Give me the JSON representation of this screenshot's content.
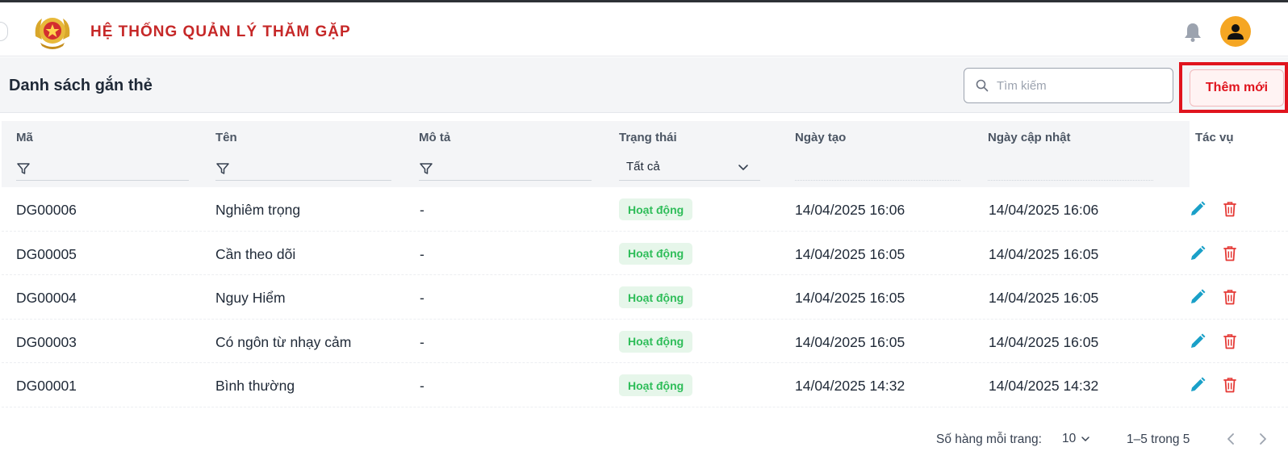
{
  "header": {
    "app_title": "HỆ THỐNG QUẢN LÝ THĂM GẶP"
  },
  "toolbar": {
    "page_title": "Danh sách gắn thẻ",
    "search_placeholder": "Tìm kiếm",
    "add_label": "Thêm mới"
  },
  "table": {
    "columns": {
      "code": "Mã",
      "name": "Tên",
      "description": "Mô tả",
      "status": "Trạng thái",
      "created": "Ngày tạo",
      "updated": "Ngày cập nhật",
      "actions": "Tác vụ"
    },
    "status_filter_value": "Tất cả",
    "rows": [
      {
        "code": "DG00006",
        "name": "Nghiêm trọng",
        "description": "-",
        "status": "Hoạt động",
        "created": "14/04/2025 16:06",
        "updated": "14/04/2025 16:06"
      },
      {
        "code": "DG00005",
        "name": "Cần theo dõi",
        "description": "-",
        "status": "Hoạt động",
        "created": "14/04/2025 16:05",
        "updated": "14/04/2025 16:05"
      },
      {
        "code": "DG00004",
        "name": "Nguy Hiểm",
        "description": "-",
        "status": "Hoạt động",
        "created": "14/04/2025 16:05",
        "updated": "14/04/2025 16:05"
      },
      {
        "code": "DG00003",
        "name": "Có ngôn từ nhạy cảm",
        "description": "-",
        "status": "Hoạt động",
        "created": "14/04/2025 16:05",
        "updated": "14/04/2025 16:05"
      },
      {
        "code": "DG00001",
        "name": "Bình thường",
        "description": "-",
        "status": "Hoạt động",
        "created": "14/04/2025 14:32",
        "updated": "14/04/2025 14:32"
      }
    ]
  },
  "pagination": {
    "rows_per_page_label": "Số hàng mỗi trang:",
    "rows_per_page_value": "10",
    "range_label": "1–5 trong 5"
  },
  "icons": {
    "logo": "police-emblem-icon",
    "bell": "bell-icon",
    "avatar": "user-icon",
    "search": "search-icon",
    "filter": "filter-icon",
    "edit": "pencil-icon",
    "delete": "trash-icon"
  },
  "colors": {
    "brand_red": "#c62828",
    "accent_red": "#e0141e",
    "status_green": "#2ebd59",
    "edit_blue": "#1aa0c8",
    "avatar_orange": "#f5a623"
  }
}
